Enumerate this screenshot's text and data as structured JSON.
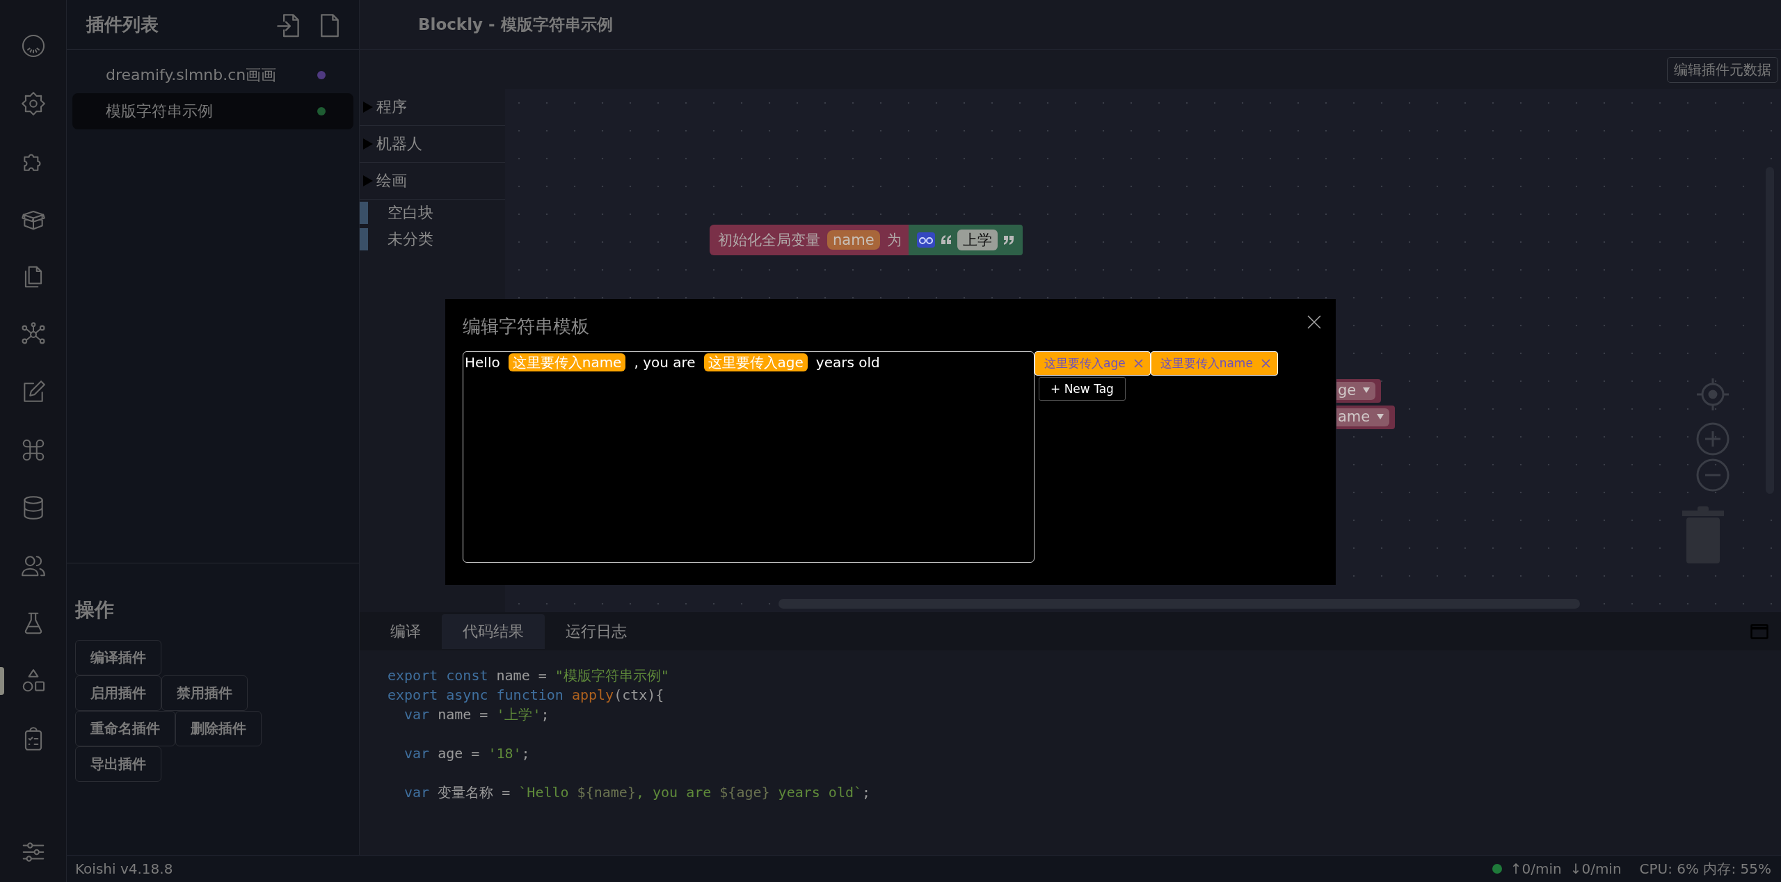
{
  "activity_bar": {
    "items": [
      {
        "selected": false
      },
      {
        "selected": false
      },
      {
        "selected": false
      },
      {
        "selected": false
      },
      {
        "selected": false
      },
      {
        "selected": false
      },
      {
        "selected": false
      },
      {
        "selected": false
      },
      {
        "selected": false
      },
      {
        "selected": false
      },
      {
        "selected": false
      },
      {
        "selected": true
      },
      {
        "selected": false
      }
    ]
  },
  "plugin_list": {
    "title": "插件列表",
    "plugins": [
      {
        "name": "dreamify.slmnb.cn画画",
        "color": "#4f3a80",
        "selected": false
      },
      {
        "name": "模版字符串示例",
        "color": "#1e5c32",
        "selected": true
      }
    ]
  },
  "actions": {
    "title": "操作",
    "button_rows": [
      [
        "编译插件"
      ],
      [
        "启用插件",
        "禁用插件"
      ],
      [
        "重命名插件",
        "删除插件"
      ],
      [
        "导出插件"
      ]
    ]
  },
  "window": {
    "title": "Blockly - 模版字符串示例"
  },
  "toolbar": {
    "button": "编辑插件元数据"
  },
  "toolbox": {
    "categories": [
      {
        "kind": "folder",
        "label": "程序",
        "expanded": false
      },
      {
        "kind": "folder",
        "label": "机器人",
        "expanded": false
      },
      {
        "kind": "folder",
        "label": "绘画",
        "expanded": false
      },
      {
        "kind": "leaf",
        "label": "空白块"
      },
      {
        "kind": "leaf",
        "label": "未分类"
      }
    ]
  },
  "workspace": {
    "blocks": [
      {
        "kind": "set_global",
        "label": "初始化全局变量",
        "variable": "name",
        "to": "为",
        "value": "上学"
      },
      {
        "kind": "getter",
        "variable": "ge"
      },
      {
        "kind": "getter",
        "variable": "ame"
      }
    ]
  },
  "bottom_panel": {
    "tabs": [
      {
        "label": "编译",
        "selected": false
      },
      {
        "label": "代码结果",
        "selected": true
      },
      {
        "label": "运行日志",
        "selected": false
      }
    ],
    "code_lines": [
      {
        "tokens": [
          {
            "kind": "keyword",
            "text": "export const"
          },
          {
            "kind": "plain",
            "text": " name = "
          },
          {
            "kind": "string",
            "text": "\"模版字符串示例\""
          }
        ]
      },
      {
        "tokens": [
          {
            "kind": "keyword",
            "text": "export async function "
          },
          {
            "kind": "func",
            "text": "apply"
          },
          {
            "kind": "plain",
            "text": "(ctx){"
          }
        ]
      },
      {
        "tokens": [
          {
            "kind": "keyword",
            "text": "var"
          },
          {
            "kind": "plain",
            "text": " name = "
          },
          {
            "kind": "string",
            "text": "'上学'"
          },
          {
            "kind": "plain",
            "text": ";"
          }
        ]
      },
      {
        "tokens": [
          {
            "kind": "keyword",
            "text": "var"
          },
          {
            "kind": "plain",
            "text": " age = "
          },
          {
            "kind": "string",
            "text": "'18'"
          },
          {
            "kind": "plain",
            "text": ";"
          }
        ]
      },
      {
        "tokens": [
          {
            "kind": "keyword",
            "text": "var"
          },
          {
            "kind": "plain",
            "text": " 变量名称 = "
          },
          {
            "kind": "string",
            "text": "`Hello "
          },
          {
            "kind": "dim",
            "text": "${name}"
          },
          {
            "kind": "string",
            "text": ", you are "
          },
          {
            "kind": "dim",
            "text": "${age}"
          },
          {
            "kind": "string",
            "text": " years old`"
          },
          {
            "kind": "plain",
            "text": ";"
          }
        ]
      }
    ]
  },
  "status_bar": {
    "version": "Koishi v4.18.8",
    "online": true,
    "upload": "↑0/min",
    "download": "↓0/min",
    "resources": "CPU: 6% 内存: 55%"
  },
  "modal": {
    "title": "编辑字符串模板",
    "segments": [
      {
        "kind": "text",
        "text": "Hello"
      },
      {
        "kind": "tag",
        "text": "这里要传入name"
      },
      {
        "kind": "text",
        "text": ", you are"
      },
      {
        "kind": "tag",
        "text": "这里要传入age"
      },
      {
        "kind": "text",
        "text": "years old"
      }
    ],
    "tags": [
      "这里要传入age",
      "这里要传入name"
    ],
    "new_tag_button": "+ New Tag"
  }
}
